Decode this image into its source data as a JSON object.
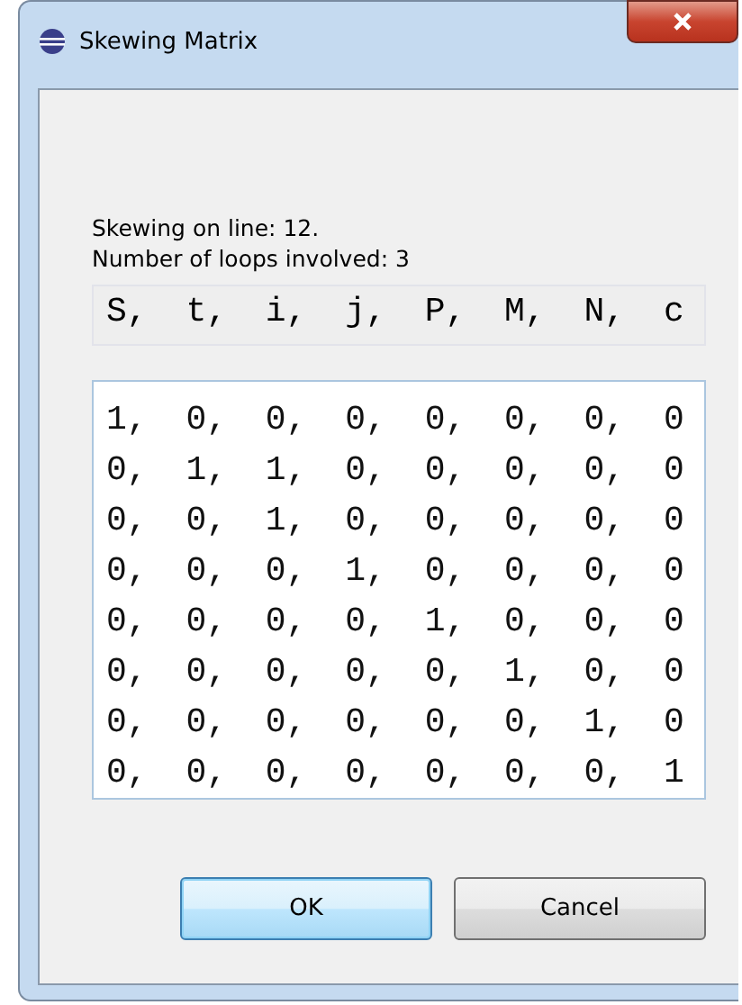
{
  "window": {
    "title": "Skewing Matrix"
  },
  "info": [
    "Skewing on line: 12.",
    "Number of loops involved: 3"
  ],
  "header": "S, t, i, j, P, M, N, c",
  "matrix_rows": [
    "1, 0, 0, 0, 0, 0, 0, 0",
    "0, 1, 1, 0, 0, 0, 0, 0",
    "0, 0, 1, 0, 0, 0, 0, 0",
    "0, 0, 0, 1, 0, 0, 0, 0",
    "0, 0, 0, 0, 1, 0, 0, 0",
    "0, 0, 0, 0, 0, 1, 0, 0",
    "0, 0, 0, 0, 0, 0, 1, 0",
    "0, 0, 0, 0, 0, 0, 0, 1"
  ],
  "buttons": [
    {
      "label": "OK",
      "default": true
    },
    {
      "label": "Cancel",
      "default": false
    }
  ]
}
